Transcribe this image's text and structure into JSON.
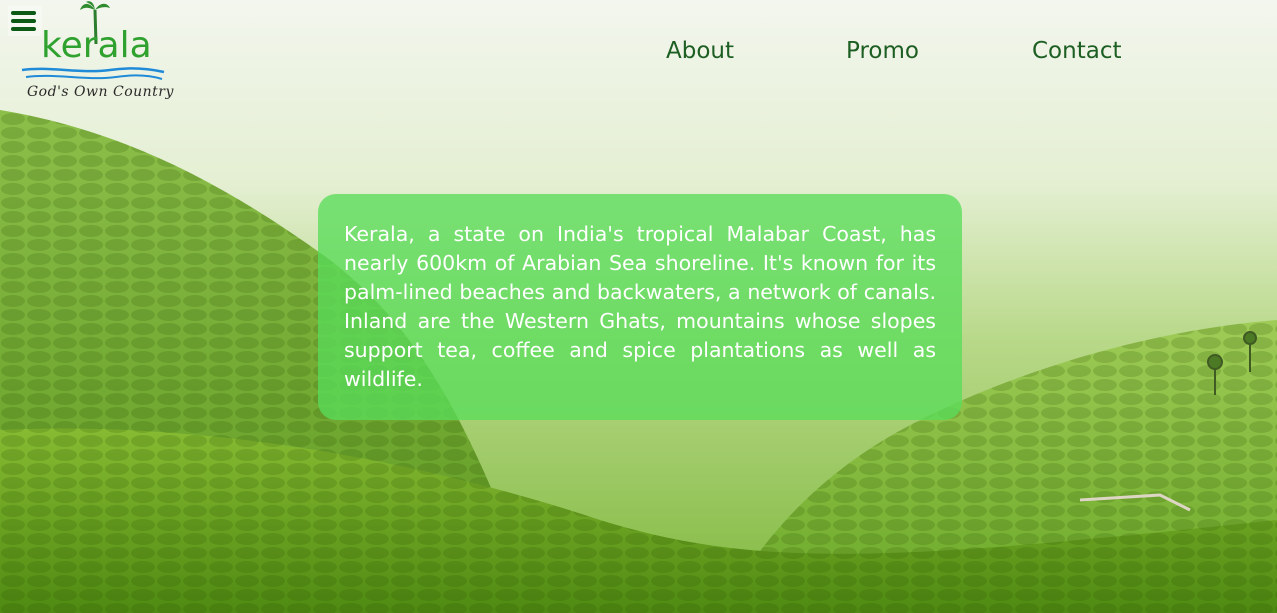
{
  "header": {
    "menu_icon": "hamburger-menu-icon",
    "logo": {
      "word": "kerala",
      "tagline": "God's Own Country"
    },
    "nav": [
      {
        "label": "About"
      },
      {
        "label": "Promo"
      },
      {
        "label": "Contact"
      }
    ]
  },
  "hero": {
    "background": "tea-plantation-hills-image",
    "card": {
      "text": "Kerala, a state on India's tropical Malabar Coast, has nearly 600km of Arabian Sea shoreline. It's known for its palm-lined beaches and backwaters, a network of canals. Inland are the Western Ghats, mountains whose slopes support tea, coffee and spice plantations as well as wildlife."
    }
  },
  "colors": {
    "nav_text": "#1d5e22",
    "card_bg": "#5adc5a",
    "card_text": "#ffffff",
    "menu_icon": "#0d5a16"
  }
}
